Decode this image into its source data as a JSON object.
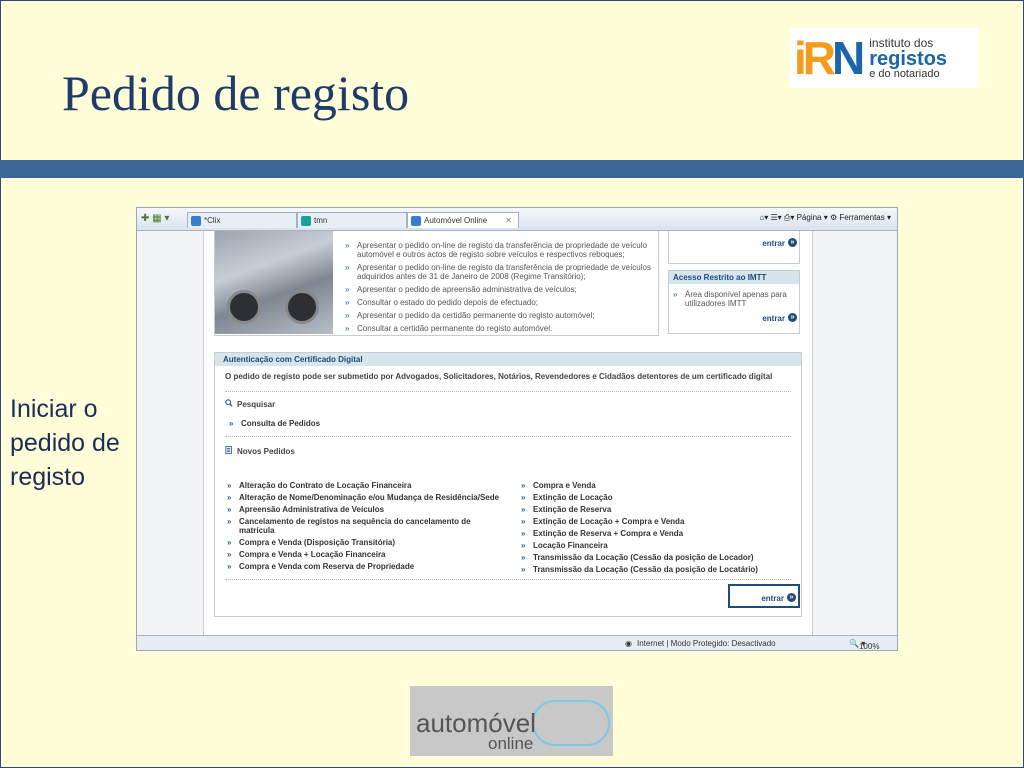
{
  "slide": {
    "title": "Pedido de registo",
    "side_text": "Iniciar o pedido de registo"
  },
  "irn_logo": {
    "line1": "instituto dos",
    "line2": "registos",
    "line3": "e do notariado"
  },
  "browser": {
    "tabs": [
      {
        "label": "*Clix"
      },
      {
        "label": "tmn"
      },
      {
        "label": "Automóvel Online"
      }
    ],
    "toolbar": {
      "page_label": "Página",
      "tools_label": "Ferramentas"
    },
    "status": {
      "zone": "Internet | Modo Protegido: Desactivado",
      "zoom": "100%"
    }
  },
  "top_list": [
    "Apresentar o pedido on-line de registo da transferência de propriedade de veículo automóvel e outros actos de registo sobre veículos e respectivos reboques;",
    "Apresentar o pedido on-line de registo da transferência de propriedade de veículos adquiridos antes de 31 de Janeiro de 2008 (Regime Transitório);",
    "Apresentar o pedido de apreensão administrativa de veículos;",
    "Consultar o estado do pedido depois de efectuado;",
    "Apresentar o pedido da certidão permanente do registo automóvel;",
    "Consultar a certidão permanente do registo automóvel."
  ],
  "right_box": {
    "entrar_top": "entrar",
    "imtt_title": "Acesso Restrito ao IMTT",
    "imtt_text": "Área disponível apenas para utilizadores IMTT",
    "entrar": "entrar"
  },
  "auth": {
    "header": "Autenticação com Certificado Digital",
    "desc": "O pedido de registo pode ser submetido por Advogados, Solicitadores, Notários, Revendedores e Cidadãos detentores de um certificado digital",
    "search_title": "Pesquisar",
    "search_item": "Consulta de Pedidos",
    "new_title": "Novos Pedidos",
    "left_items": [
      "Alteração do Contrato de Locação Financeira",
      "Alteração de Nome/Denominação e/ou Mudança de Residência/Sede",
      "Apreensão Administrativa de Veículos",
      "Cancelamento de registos na sequência do cancelamento de matrícula",
      "Compra e Venda (Disposição Transitória)",
      "Compra e Venda + Locação Financeira",
      "Compra e Venda com Reserva de Propriedade"
    ],
    "right_items": [
      "Compra e Venda",
      "Extinção de Locação",
      "Extinção de Reserva",
      "Extinção de Locação + Compra e Venda",
      "Extinção de Reserva + Compra e Venda",
      "Locação Financeira",
      "Transmissão da Locação (Cessão da posição de Locador)",
      "Transmissão da Locação (Cessão da posição de Locatário)"
    ],
    "entrar": "entrar"
  },
  "ao_logo": {
    "line1": "automóvel",
    "line2": "online"
  }
}
